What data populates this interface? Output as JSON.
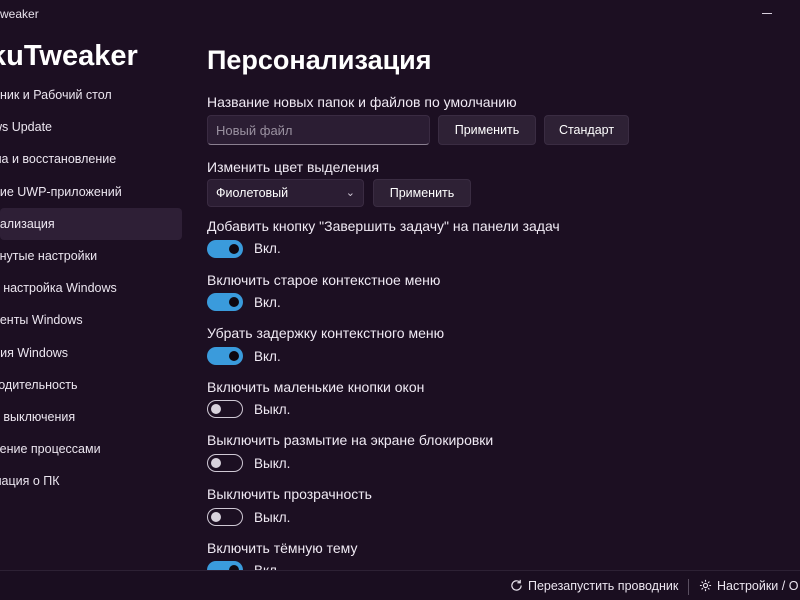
{
  "window": {
    "title": "weaker"
  },
  "sidebar": {
    "app_title": "kuTweaker",
    "items": [
      {
        "label": "одник и Рабочий стол"
      },
      {
        "label": "ows Update"
      },
      {
        "label": "ема и восстановление"
      },
      {
        "label": "ение UWP-приложений"
      },
      {
        "label": "онализация"
      },
      {
        "label": "винутые настройки"
      },
      {
        "label": "ая настройка Windows"
      },
      {
        "label": "оненты Windows"
      },
      {
        "label": "ация Windows"
      },
      {
        "label": "зводительность"
      },
      {
        "label": "ер выключения"
      },
      {
        "label": "вление процессами"
      },
      {
        "label": "рмация о ПК"
      }
    ],
    "active_index": 4
  },
  "main": {
    "title": "Персонализация",
    "folder_name": {
      "label": "Название новых папок и файлов по умолчанию",
      "placeholder": "Новый файл",
      "value": "",
      "apply_label": "Применить",
      "default_label": "Стандарт"
    },
    "accent": {
      "label": "Изменить цвет выделения",
      "selected": "Фиолетовый",
      "apply_label": "Применить"
    },
    "toggles": [
      {
        "label": "Добавить кнопку \"Завершить задачу\" на панели задач",
        "state": "Вкл.",
        "on": true
      },
      {
        "label": "Включить старое контекстное меню",
        "state": "Вкл.",
        "on": true
      },
      {
        "label": "Убрать задержку контекстного меню",
        "state": "Вкл.",
        "on": true
      },
      {
        "label": "Включить маленькие кнопки окон",
        "state": "Выкл.",
        "on": false
      },
      {
        "label": "Выключить размытие на экране блокировки",
        "state": "Выкл.",
        "on": false
      },
      {
        "label": "Выключить прозрачность",
        "state": "Выкл.",
        "on": false
      },
      {
        "label": "Включить тёмную тему",
        "state": "Вкл.",
        "on": true
      }
    ]
  },
  "bottom": {
    "restart_label": "Перезапустить проводник",
    "restart_icon": "refresh-icon",
    "settings_label": "Настройки / О",
    "settings_icon": "gear-icon"
  },
  "colors": {
    "background": "#1c0f22",
    "toggle_on": "#3a9bdc",
    "active_item": "#2e1f36"
  }
}
